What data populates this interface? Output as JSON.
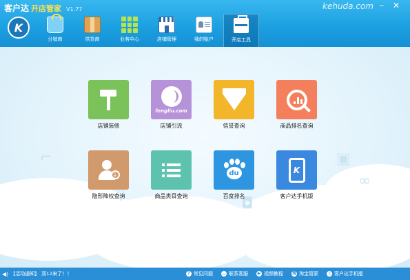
{
  "app": {
    "title": "客户达",
    "subtitle": "开店管家",
    "version": "V1.77",
    "site_url": "kehuda.com",
    "logo_letter": "K"
  },
  "window_controls": {
    "minimize": "–",
    "close": "✕"
  },
  "nav": {
    "items": [
      {
        "label": "分销商",
        "icon": "shopping-bag-icon"
      },
      {
        "label": "供货商",
        "icon": "box-icon"
      },
      {
        "label": "业务中心",
        "icon": "grid-icon"
      },
      {
        "label": "店铺管理",
        "icon": "storefront-icon"
      },
      {
        "label": "我的账户",
        "icon": "id-card-icon"
      },
      {
        "label": "开店工具",
        "icon": "toolkit-icon",
        "active": true
      }
    ]
  },
  "tools": {
    "items": [
      {
        "label": "店铺装修",
        "icon": "paint-roller-icon",
        "color": "#7cc25a"
      },
      {
        "label": "店铺引流",
        "icon": "fengliu-logo-icon",
        "color": "#b692d8",
        "caption": "fengliu.com"
      },
      {
        "label": "信誉查询",
        "icon": "diamond-icon",
        "color": "#f3b52a"
      },
      {
        "label": "商品排名查询",
        "icon": "chart-magnifier-icon",
        "color": "#f47f5c"
      },
      {
        "label": "隐形降权查询",
        "icon": "user-download-icon",
        "color": "#d09a6c"
      },
      {
        "label": "商品类目查询",
        "icon": "list-icon",
        "color": "#5ec3ae"
      },
      {
        "label": "百度排名",
        "icon": "baidu-paw-icon",
        "color": "#2e95e0",
        "caption": "du"
      },
      {
        "label": "客户达手机版",
        "icon": "mobile-phone-icon",
        "color": "#3a88df",
        "caption": "K"
      }
    ]
  },
  "status_bar": {
    "notice_label": "【活动通知】",
    "notice_text": "双12来了！！",
    "links": [
      {
        "label": "常见问题",
        "icon": "question-icon"
      },
      {
        "label": "联系客服",
        "icon": "chat-icon"
      },
      {
        "label": "视频教程",
        "icon": "video-icon"
      },
      {
        "label": "淘宝管家",
        "icon": "taobao-icon"
      },
      {
        "label": "客户达手机版",
        "icon": "phone-icon"
      }
    ]
  }
}
